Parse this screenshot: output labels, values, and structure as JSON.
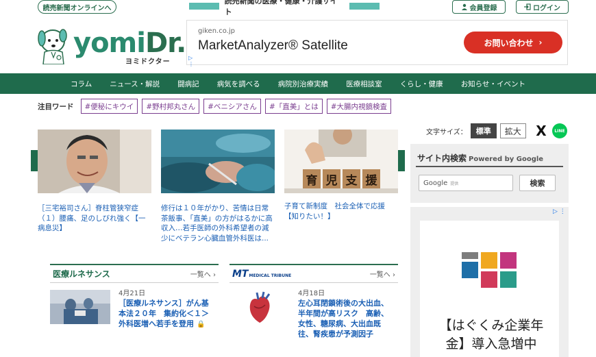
{
  "topbar": {
    "yomiuri_link": "読売新聞オンラインへ",
    "tagline": "読売新聞の医療・健康・介護サイト",
    "member_register": "会員登録",
    "login": "ログイン"
  },
  "logo": {
    "wordmark_yomi": "yomi",
    "wordmark_dr": "Dr.",
    "kana": "ヨミドクター"
  },
  "ad_banner": {
    "domain": "giken.co.jp",
    "product": "MarketAnalyzer® Satellite",
    "cta": "お問い合わせ",
    "cta_arrow": "›"
  },
  "nav": {
    "items": [
      "コラム",
      "ニュース・解説",
      "闘病記",
      "病気を調べる",
      "病院別治療実績",
      "医療相談室",
      "くらし・健康",
      "お知らせ・イベント"
    ]
  },
  "hotwords": {
    "label": "注目ワード",
    "tags": [
      "#便秘にキウイ",
      "#野村邦丸さん",
      "#ベニシアさん",
      "#「直美」とは",
      "#大腸内視鏡検査"
    ]
  },
  "carousel": {
    "prev": "〈",
    "next": "〉",
    "cards": [
      {
        "caption": "［三宅裕司さん］脊柱管狭窄症（１）腰痛、足のしびれ強く【一病息災】"
      },
      {
        "caption": "修行は１０年がかり、苦情は日常茶飯事、「直美」の方がはるかに高収入…若手医師の外科希望者の減少にベテラン心臓血管外科医は..."
      },
      {
        "caption": "子育て新制度　社会全体で応援【知りたい！】",
        "image_text": "育児支援"
      }
    ]
  },
  "font_size": {
    "label": "文字サイズ：",
    "standard": "標準",
    "large": "拡大"
  },
  "social": {
    "x": "X",
    "line": "LINE"
  },
  "site_search": {
    "title": "サイト内検索",
    "powered": "Powered by Google",
    "input_brand": "Google",
    "input_sub": "提供",
    "button": "検索"
  },
  "side_ad": {
    "headline": "【はぐくみ企業年金】導入急増中",
    "adchoice": "▷ ⋮"
  },
  "left_section": {
    "title": "医療ルネサンス",
    "more": "一覧へ ›",
    "date": "4月21日",
    "entry_title": "［医療ルネサンス］がん基本法２０年　集約化＜１＞外科医増へ若手を登用"
  },
  "right_section": {
    "logo_main": "MT",
    "logo_sub": "MEDICAL TRIBUNE",
    "more": "一覧へ ›",
    "date": "4月18日",
    "entry_title": "左心耳閉鎖術後の大出血、半年間が高リスク　高齢、女性、糖尿病、大出血既往、腎疾患が予測因子"
  }
}
